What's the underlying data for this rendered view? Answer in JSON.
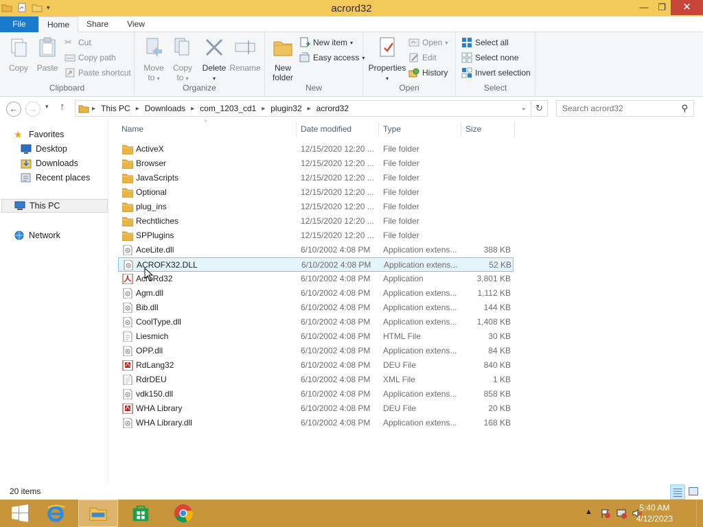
{
  "window": {
    "title": "acrord32"
  },
  "ribbon_tabs": {
    "file": "File",
    "home": "Home",
    "share": "Share",
    "view": "View"
  },
  "ribbon": {
    "clipboard": {
      "label": "Clipboard",
      "copy": "Copy",
      "paste": "Paste",
      "cut": "Cut",
      "copy_path": "Copy path",
      "paste_shortcut": "Paste shortcut"
    },
    "organize": {
      "label": "Organize",
      "move_to_1": "Move",
      "move_to_2": "to",
      "copy_to_1": "Copy",
      "copy_to_2": "to",
      "delete": "Delete",
      "rename": "Rename"
    },
    "new": {
      "label": "New",
      "new_folder_1": "New",
      "new_folder_2": "folder",
      "new_item": "New item",
      "easy_access": "Easy access"
    },
    "open": {
      "label": "Open",
      "properties": "Properties",
      "open": "Open",
      "edit": "Edit",
      "history": "History"
    },
    "select": {
      "label": "Select",
      "select_all": "Select all",
      "select_none": "Select none",
      "invert": "Invert selection"
    }
  },
  "address": {
    "crumbs": [
      "This PC",
      "Downloads",
      "com_1203_cd1",
      "plugin32",
      "acrord32"
    ],
    "search_placeholder": "Search acrord32"
  },
  "nav": {
    "favorites": "Favorites",
    "desktop": "Desktop",
    "downloads": "Downloads",
    "recent": "Recent places",
    "this_pc": "This PC",
    "network": "Network"
  },
  "columns": {
    "name": "Name",
    "date": "Date modified",
    "type": "Type",
    "size": "Size"
  },
  "files": [
    {
      "name": "ActiveX",
      "date": "12/15/2020 12:20 ...",
      "type": "File folder",
      "size": "",
      "icon": "folder"
    },
    {
      "name": "Browser",
      "date": "12/15/2020 12:20 ...",
      "type": "File folder",
      "size": "",
      "icon": "folder"
    },
    {
      "name": "JavaScripts",
      "date": "12/15/2020 12:20 ...",
      "type": "File folder",
      "size": "",
      "icon": "folder"
    },
    {
      "name": "Optional",
      "date": "12/15/2020 12:20 ...",
      "type": "File folder",
      "size": "",
      "icon": "folder"
    },
    {
      "name": "plug_ins",
      "date": "12/15/2020 12:20 ...",
      "type": "File folder",
      "size": "",
      "icon": "folder"
    },
    {
      "name": "Rechtliches",
      "date": "12/15/2020 12:20 ...",
      "type": "File folder",
      "size": "",
      "icon": "folder"
    },
    {
      "name": "SPPlugins",
      "date": "12/15/2020 12:20 ...",
      "type": "File folder",
      "size": "",
      "icon": "folder"
    },
    {
      "name": "AceLite.dll",
      "date": "6/10/2002 4:08 PM",
      "type": "Application extens...",
      "size": "388 KB",
      "icon": "dll"
    },
    {
      "name": "ACROFX32.DLL",
      "date": "6/10/2002 4:08 PM",
      "type": "Application extens...",
      "size": "52 KB",
      "icon": "dll",
      "selected": true
    },
    {
      "name": "AcroRd32",
      "date": "6/10/2002 4:08 PM",
      "type": "Application",
      "size": "3,801 KB",
      "icon": "acrobat"
    },
    {
      "name": "Agm.dll",
      "date": "6/10/2002 4:08 PM",
      "type": "Application extens...",
      "size": "1,112 KB",
      "icon": "dll"
    },
    {
      "name": "Bib.dll",
      "date": "6/10/2002 4:08 PM",
      "type": "Application extens...",
      "size": "144 KB",
      "icon": "dll"
    },
    {
      "name": "CoolType.dll",
      "date": "6/10/2002 4:08 PM",
      "type": "Application extens...",
      "size": "1,408 KB",
      "icon": "dll"
    },
    {
      "name": "Liesmich",
      "date": "6/10/2002 4:08 PM",
      "type": "HTML File",
      "size": "30 KB",
      "icon": "doc"
    },
    {
      "name": "OPP.dll",
      "date": "6/10/2002 4:08 PM",
      "type": "Application extens...",
      "size": "84 KB",
      "icon": "dll"
    },
    {
      "name": "RdLang32",
      "date": "6/10/2002 4:08 PM",
      "type": "DEU File",
      "size": "840 KB",
      "icon": "pdfdoc"
    },
    {
      "name": "RdrDEU",
      "date": "6/10/2002 4:08 PM",
      "type": "XML File",
      "size": "1 KB",
      "icon": "doc"
    },
    {
      "name": "vdk150.dll",
      "date": "6/10/2002 4:08 PM",
      "type": "Application extens...",
      "size": "858 KB",
      "icon": "dll"
    },
    {
      "name": "WHA Library",
      "date": "6/10/2002 4:08 PM",
      "type": "DEU File",
      "size": "20 KB",
      "icon": "pdfdoc"
    },
    {
      "name": "WHA Library.dll",
      "date": "6/10/2002 4:08 PM",
      "type": "Application extens...",
      "size": "168 KB",
      "icon": "dll"
    }
  ],
  "status": {
    "count": "20 items"
  },
  "taskbar": {
    "time": "5:40 AM",
    "date": "4/12/2023"
  },
  "colors": {
    "titlebar": "#f3c95a",
    "file_tab": "#1979ca",
    "taskbar": "#c7953c",
    "selection": "#e5f3fb",
    "close": "#c7453b"
  }
}
